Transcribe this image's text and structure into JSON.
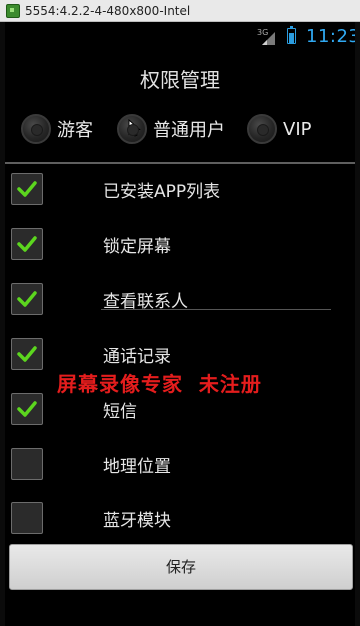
{
  "emulator": {
    "title": "5554:4.2.2-4-480x800-Intel"
  },
  "status_bar": {
    "network": "3G",
    "time": "11:23",
    "accent_color": "#30a9f2"
  },
  "screen": {
    "title": "权限管理",
    "roles": [
      {
        "label": "游客"
      },
      {
        "label": "普通用户"
      },
      {
        "label": "VIP"
      }
    ],
    "permissions": [
      {
        "label": "已安装APP列表",
        "checked": true
      },
      {
        "label": "锁定屏幕",
        "checked": true
      },
      {
        "label": "查看联系人",
        "checked": true
      },
      {
        "label": "通话记录",
        "checked": true
      },
      {
        "label": "短信",
        "checked": true
      },
      {
        "label": "地理位置",
        "checked": false
      },
      {
        "label": "蓝牙模块",
        "checked": false
      }
    ],
    "save_label": "保存"
  },
  "watermark": {
    "text": "屏幕录像专家  未注册",
    "color": "#e41d1d"
  }
}
